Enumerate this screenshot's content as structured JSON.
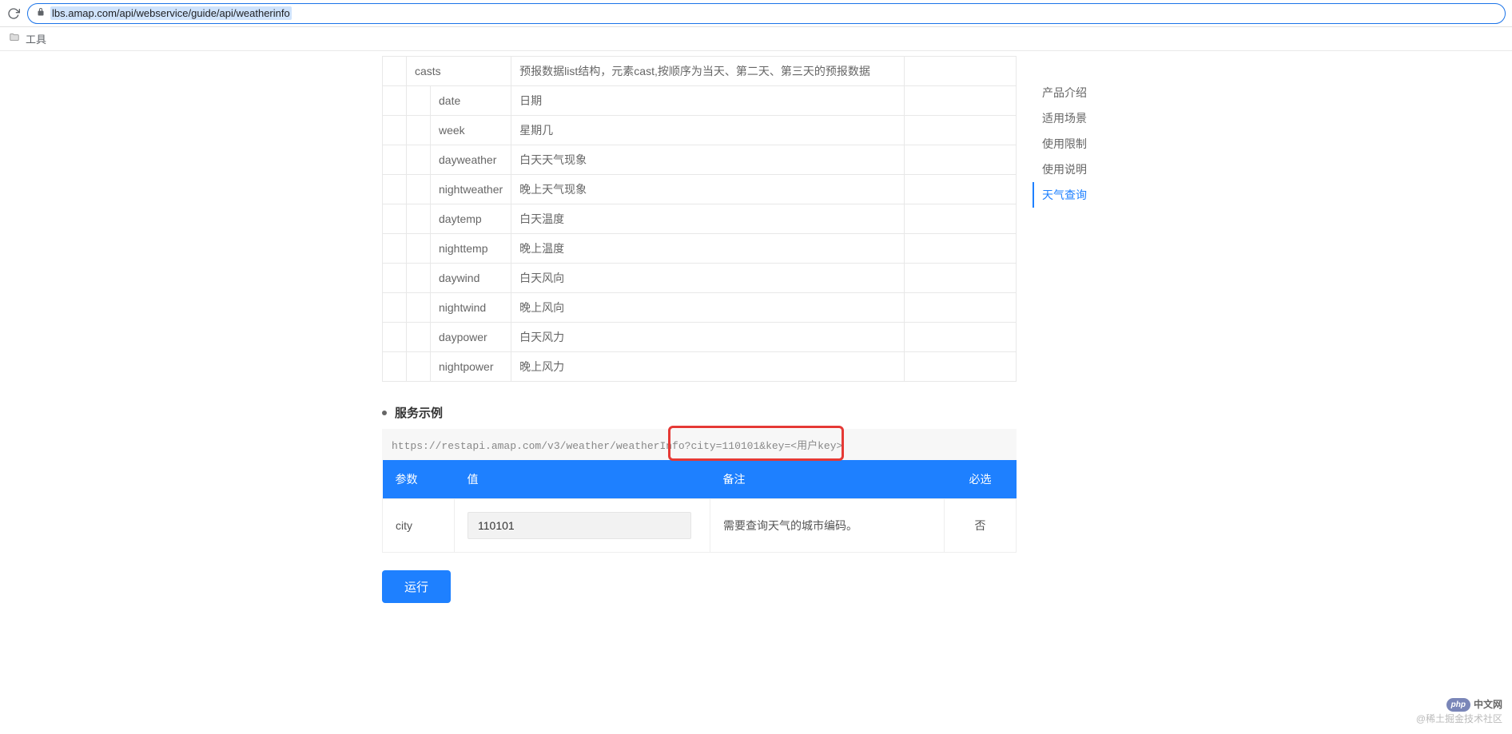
{
  "browser": {
    "url": "lbs.amap.com/api/webservice/guide/api/weatherinfo",
    "bookmark_label": "工具"
  },
  "api_fields": [
    {
      "level": 1,
      "name": "casts",
      "desc": "预报数据list结构，元素cast,按顺序为当天、第二天、第三天的预报数据"
    },
    {
      "level": 2,
      "name": "date",
      "desc": "日期"
    },
    {
      "level": 2,
      "name": "week",
      "desc": "星期几"
    },
    {
      "level": 2,
      "name": "dayweather",
      "desc": "白天天气现象"
    },
    {
      "level": 2,
      "name": "nightweather",
      "desc": "晚上天气现象"
    },
    {
      "level": 2,
      "name": "daytemp",
      "desc": "白天温度"
    },
    {
      "level": 2,
      "name": "nighttemp",
      "desc": "晚上温度"
    },
    {
      "level": 2,
      "name": "daywind",
      "desc": "白天风向"
    },
    {
      "level": 2,
      "name": "nightwind",
      "desc": "晚上风向"
    },
    {
      "level": 2,
      "name": "daypower",
      "desc": "白天风力"
    },
    {
      "level": 2,
      "name": "nightpower",
      "desc": "晚上风力"
    }
  ],
  "example": {
    "title": "服务示例",
    "scheme": "https:",
    "rest": "//restapi.amap.com/v3/weather/weatherInfo?city=110101&key=<用户key>"
  },
  "param_table": {
    "headers": {
      "param": "参数",
      "value": "值",
      "remark": "备注",
      "required": "必选"
    },
    "rows": [
      {
        "param": "city",
        "value": "110101",
        "remark": "需要查询天气的城市编码。",
        "required": "否"
      }
    ]
  },
  "buttons": {
    "run": "运行"
  },
  "toc": {
    "items": [
      {
        "label": "产品介绍",
        "active": false
      },
      {
        "label": "适用场景",
        "active": false
      },
      {
        "label": "使用限制",
        "active": false
      },
      {
        "label": "使用说明",
        "active": false
      },
      {
        "label": "天气查询",
        "active": true
      }
    ]
  },
  "watermark": {
    "brand_prefix": "php",
    "brand_text": "中文网",
    "sub": "@稀土掘金技术社区"
  }
}
